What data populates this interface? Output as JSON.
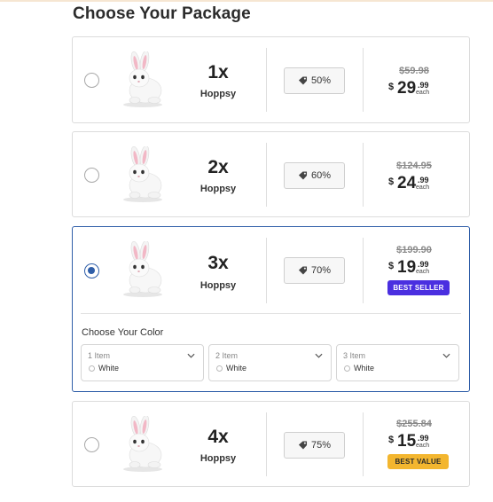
{
  "page": {
    "title": "Choose Your Package"
  },
  "packages": [
    {
      "qty": "1x",
      "product": "Hoppsy",
      "discount": "50%",
      "old_price": "$59.98",
      "currency": "$",
      "dollars": "29",
      "cents": ".99",
      "each": "each",
      "badge": "",
      "selected": false
    },
    {
      "qty": "2x",
      "product": "Hoppsy",
      "discount": "60%",
      "old_price": "$124.95",
      "currency": "$",
      "dollars": "24",
      "cents": ".99",
      "each": "each",
      "badge": "",
      "selected": false
    },
    {
      "qty": "3x",
      "product": "Hoppsy",
      "discount": "70%",
      "old_price": "$199.90",
      "currency": "$",
      "dollars": "19",
      "cents": ".99",
      "each": "each",
      "badge": "BEST SELLER",
      "selected": true
    },
    {
      "qty": "4x",
      "product": "Hoppsy",
      "discount": "75%",
      "old_price": "$255.84",
      "currency": "$",
      "dollars": "15",
      "cents": ".99",
      "each": "each",
      "badge": "BEST VALUE",
      "selected": false
    }
  ],
  "color_picker": {
    "title": "Choose Your Color",
    "items": [
      {
        "label": "1 Item",
        "value": "White"
      },
      {
        "label": "2 Item",
        "value": "White"
      },
      {
        "label": "3 Item",
        "value": "White"
      }
    ]
  },
  "icons": {
    "tag": "tag-icon",
    "chevron": "chevron-down-icon",
    "product": "bunny-plush-image"
  },
  "colors": {
    "accent": "#2f5ea8",
    "best_seller": "#4a2fe0",
    "best_value": "#f3b62f",
    "old_price": "#8a8a8a"
  }
}
